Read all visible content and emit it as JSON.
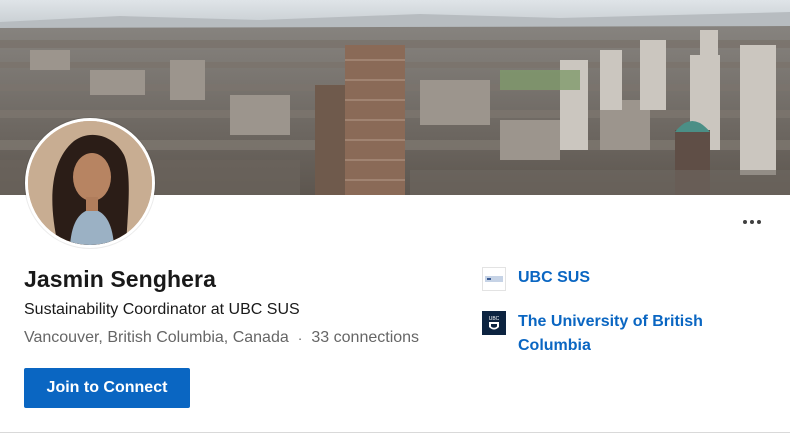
{
  "profile": {
    "name": "Jasmin Senghera",
    "headline": "Sustainability Coordinator at UBC SUS",
    "location": "Vancouver, British Columbia, Canada",
    "separator": "·",
    "connections": "33 connections"
  },
  "actions": {
    "join_label": "Join to Connect",
    "more_icon": "ellipsis-icon"
  },
  "experience": [
    {
      "name": "UBC SUS",
      "logo": "ubc-sus-logo"
    },
    {
      "name": "The University of British Columbia",
      "logo": "ubc-crest-logo",
      "logo_text": "UBC"
    }
  ],
  "colors": {
    "accent": "#0a66c2",
    "primary_text": "#191919",
    "secondary_text": "#666666",
    "ubc_navy": "#0c2340"
  }
}
